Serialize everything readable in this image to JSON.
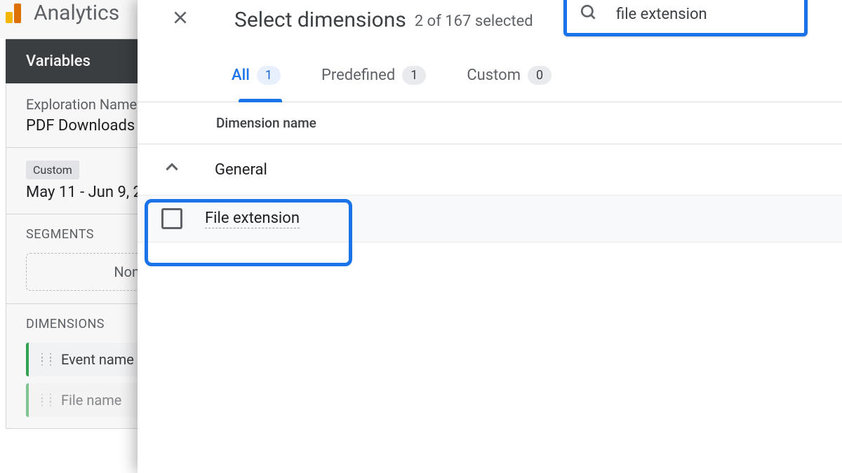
{
  "background": {
    "analytics_title": "Analytics",
    "variables_header": "Variables",
    "exploration_label": "Exploration Name",
    "exploration_value": "PDF Downloads",
    "date_chip": "Custom",
    "date_range": "May 11 - Jun 9, 2",
    "segments_title": "SEGMENTS",
    "segments_none": "None",
    "dimensions_title": "DIMENSIONS",
    "dim_items": [
      "Event name",
      "File name"
    ]
  },
  "modal": {
    "title": "Select dimensions",
    "subtitle": "2 of 167 selected",
    "search_value": "file extension",
    "tabs": [
      {
        "label": "All",
        "count": "1",
        "active": true
      },
      {
        "label": "Predefined",
        "count": "1",
        "active": false
      },
      {
        "label": "Custom",
        "count": "0",
        "active": false
      }
    ],
    "column_header": "Dimension name",
    "group_name": "General",
    "dimension_item": "File extension"
  }
}
